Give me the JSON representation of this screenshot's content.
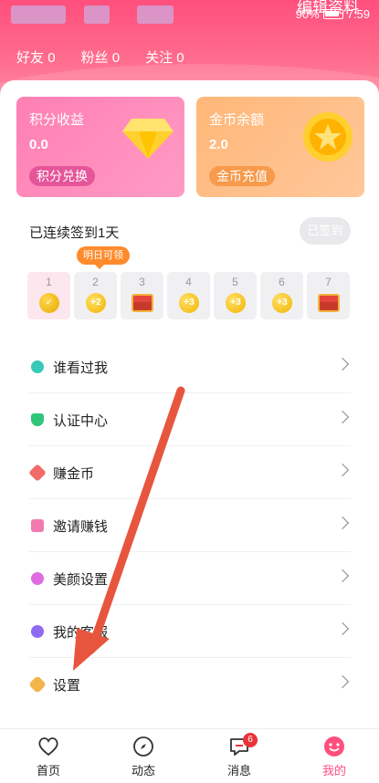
{
  "status": {
    "battery": "90%",
    "time": "7:59"
  },
  "header": {
    "edit_label": "编辑资料",
    "stats": [
      {
        "label": "好友",
        "value": "0"
      },
      {
        "label": "粉丝",
        "value": "0"
      },
      {
        "label": "关注",
        "value": "0"
      }
    ]
  },
  "cards": {
    "points": {
      "title": "积分收益",
      "value": "0.0",
      "button": "积分兑换"
    },
    "coins": {
      "title": "金币余额",
      "value": "2.0",
      "button": "金币充值"
    }
  },
  "checkin": {
    "title": "已连续签到1天",
    "button": "已签到",
    "tooltip": "明日可领",
    "days": [
      {
        "day": "1",
        "reward": ""
      },
      {
        "day": "2",
        "reward": "+2"
      },
      {
        "day": "3",
        "reward": ""
      },
      {
        "day": "4",
        "reward": "+3"
      },
      {
        "day": "5",
        "reward": "+3"
      },
      {
        "day": "6",
        "reward": "+3"
      },
      {
        "day": "7",
        "reward": ""
      }
    ]
  },
  "menu": [
    {
      "label": "谁看过我",
      "color": "#3ac8b8"
    },
    {
      "label": "认证中心",
      "color": "#2fc67b"
    },
    {
      "label": "赚金币",
      "color": "#f26b6b"
    },
    {
      "label": "邀请赚钱",
      "color": "#f27ab0"
    },
    {
      "label": "美颜设置",
      "color": "#e06be0"
    },
    {
      "label": "我的客服",
      "color": "#8f6bf2"
    },
    {
      "label": "设置",
      "color": "#f2b44b"
    }
  ],
  "tabs": [
    {
      "label": "首页"
    },
    {
      "label": "动态"
    },
    {
      "label": "消息",
      "badge": "6"
    },
    {
      "label": "我的"
    }
  ],
  "colors": {
    "brand": "#ff4f7d",
    "arrow": "#e8553e"
  }
}
